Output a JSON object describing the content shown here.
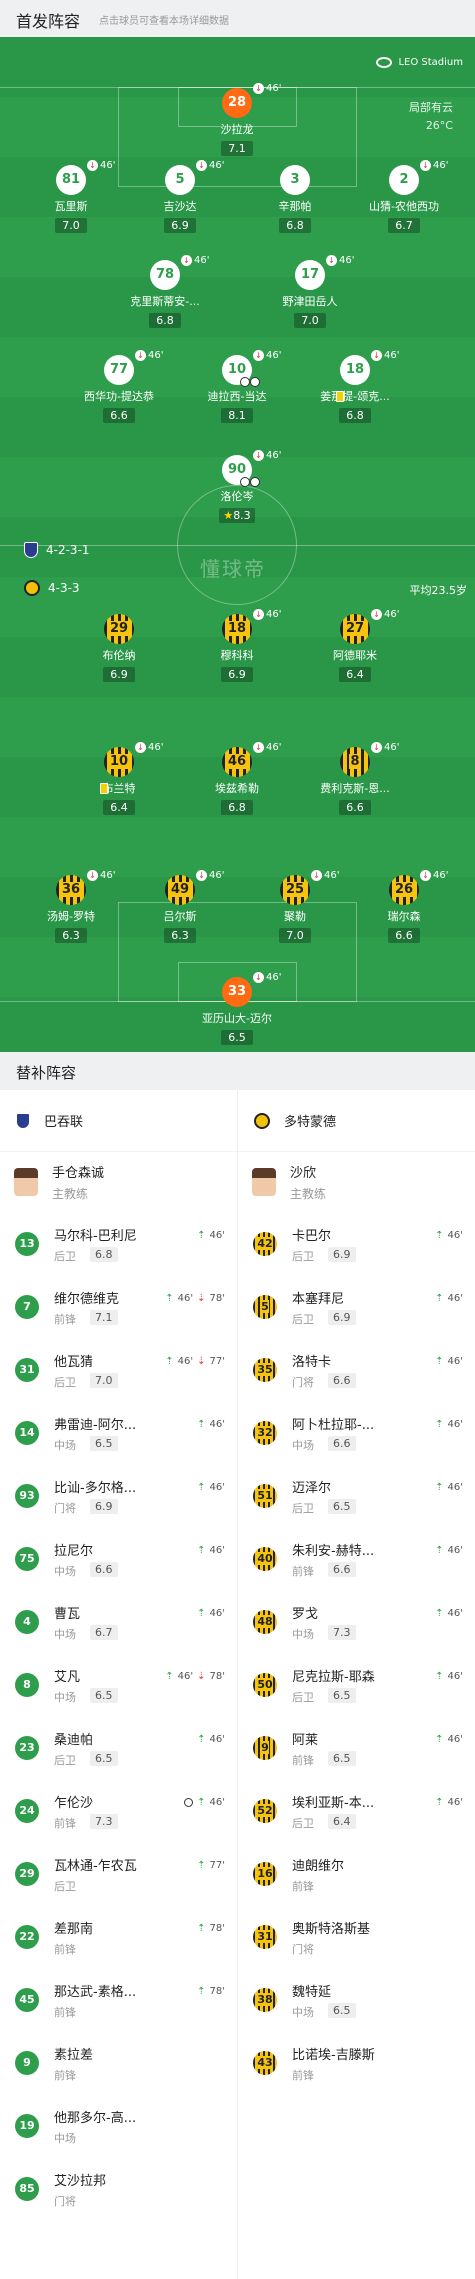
{
  "header": {
    "title": "首发阵容",
    "subtitle": "点击球员可查看本场详细数据"
  },
  "venue": {
    "name": "LEO Stadium",
    "icon": "stadium-icon"
  },
  "weather": {
    "condition": "局部有云",
    "temperature": "26°C"
  },
  "watermark": "懂球帝",
  "home": {
    "formation": "4-2-3-1",
    "players": [
      {
        "num": "28",
        "name": "沙拉龙",
        "rating": "7.1",
        "sub": "46'",
        "gk": true
      },
      {
        "num": "81",
        "name": "瓦里斯",
        "rating": "7.0",
        "sub": "46'"
      },
      {
        "num": "5",
        "name": "吉沙达",
        "rating": "6.9",
        "sub": "46'"
      },
      {
        "num": "3",
        "name": "辛那帕",
        "rating": "6.8",
        "sub": ""
      },
      {
        "num": "2",
        "name": "山猜-农他西功",
        "rating": "6.7",
        "sub": "46'"
      },
      {
        "num": "78",
        "name": "克里斯蒂安-...",
        "rating": "6.8",
        "sub": "46'"
      },
      {
        "num": "17",
        "name": "野津田岳人",
        "rating": "7.0",
        "sub": "46'"
      },
      {
        "num": "77",
        "name": "西华功-提达恭",
        "rating": "6.6",
        "sub": "46'"
      },
      {
        "num": "10",
        "name": "迪拉西-当达",
        "rating": "8.1",
        "sub": "46'"
      },
      {
        "num": "18",
        "name": "姜那提-颂克...",
        "rating": "6.8",
        "sub": "46'"
      },
      {
        "num": "90",
        "name": "洛伦岑",
        "rating": "8.3",
        "sub": "46'"
      }
    ]
  },
  "away": {
    "formation": "4-3-3",
    "avg_age": "平均23.5岁",
    "players": [
      {
        "num": "29",
        "name": "布伦纳",
        "rating": "6.9",
        "sub": ""
      },
      {
        "num": "18",
        "name": "穆科科",
        "rating": "6.9",
        "sub": "46'"
      },
      {
        "num": "27",
        "name": "阿德耶米",
        "rating": "6.4",
        "sub": "46'"
      },
      {
        "num": "10",
        "name": "布兰特",
        "rating": "6.4",
        "sub": "46'"
      },
      {
        "num": "46",
        "name": "埃兹希勒",
        "rating": "6.8",
        "sub": "46'"
      },
      {
        "num": "8",
        "name": "费利克斯-恩...",
        "rating": "6.6",
        "sub": "46'"
      },
      {
        "num": "36",
        "name": "汤姆-罗特",
        "rating": "6.3",
        "sub": "46'"
      },
      {
        "num": "49",
        "name": "吕尔斯",
        "rating": "6.3",
        "sub": "46'"
      },
      {
        "num": "25",
        "name": "聚勒",
        "rating": "7.0",
        "sub": "46'"
      },
      {
        "num": "26",
        "name": "瑞尔森",
        "rating": "6.6",
        "sub": "46'"
      },
      {
        "num": "33",
        "name": "亚历山大-迈尔",
        "rating": "6.5",
        "sub": "46'"
      }
    ]
  },
  "subs": {
    "title": "替补阵容",
    "home_team": "巴吞联",
    "away_team": "多特蒙德",
    "home_coach": {
      "name": "手仓森诚",
      "role": "主教练"
    },
    "away_coach": {
      "name": "沙欣",
      "role": "主教练"
    },
    "home": [
      {
        "num": "13",
        "name": "马尔科-巴利尼",
        "pos": "后卫",
        "rating": "6.8",
        "events": [
          {
            "t": "in",
            "m": "46'"
          }
        ]
      },
      {
        "num": "7",
        "name": "维尔德维克",
        "pos": "前锋",
        "rating": "7.1",
        "events": [
          {
            "t": "in",
            "m": "46'"
          },
          {
            "t": "out",
            "m": "78'"
          }
        ]
      },
      {
        "num": "31",
        "name": "他瓦猜",
        "pos": "后卫",
        "rating": "7.0",
        "events": [
          {
            "t": "in",
            "m": "46'"
          },
          {
            "t": "out",
            "m": "77'"
          }
        ]
      },
      {
        "num": "14",
        "name": "弗雷迪-阿尔...",
        "pos": "中场",
        "rating": "6.5",
        "events": [
          {
            "t": "in",
            "m": "46'"
          }
        ]
      },
      {
        "num": "93",
        "name": "比讪-多尔格...",
        "pos": "门将",
        "rating": "6.9",
        "events": [
          {
            "t": "in",
            "m": "46'"
          }
        ]
      },
      {
        "num": "75",
        "name": "拉尼尔",
        "pos": "中场",
        "rating": "6.6",
        "events": [
          {
            "t": "in",
            "m": "46'"
          }
        ]
      },
      {
        "num": "4",
        "name": "曹瓦",
        "pos": "中场",
        "rating": "6.7",
        "events": [
          {
            "t": "in",
            "m": "46'"
          }
        ]
      },
      {
        "num": "8",
        "name": "艾凡",
        "pos": "中场",
        "rating": "6.5",
        "events": [
          {
            "t": "in",
            "m": "46'"
          },
          {
            "t": "out",
            "m": "78'"
          }
        ]
      },
      {
        "num": "23",
        "name": "桑迪帕",
        "pos": "后卫",
        "rating": "6.5",
        "events": [
          {
            "t": "in",
            "m": "46'"
          }
        ]
      },
      {
        "num": "24",
        "name": "乍伦沙",
        "pos": "前锋",
        "rating": "7.3",
        "events": [
          {
            "t": "goal",
            "m": ""
          },
          {
            "t": "in",
            "m": "46'"
          }
        ]
      },
      {
        "num": "29",
        "name": "瓦林通-乍农瓦",
        "pos": "后卫",
        "rating": "",
        "events": [
          {
            "t": "in",
            "m": "77'"
          }
        ]
      },
      {
        "num": "22",
        "name": "差那南",
        "pos": "前锋",
        "rating": "",
        "events": [
          {
            "t": "in",
            "m": "78'"
          }
        ]
      },
      {
        "num": "45",
        "name": "那达武-素格...",
        "pos": "前锋",
        "rating": "",
        "events": [
          {
            "t": "in",
            "m": "78'"
          }
        ]
      },
      {
        "num": "9",
        "name": "素拉差",
        "pos": "前锋",
        "rating": "",
        "events": []
      },
      {
        "num": "19",
        "name": "他那多尔-高...",
        "pos": "中场",
        "rating": "",
        "events": []
      },
      {
        "num": "85",
        "name": "艾沙拉邦",
        "pos": "门将",
        "rating": "",
        "events": []
      }
    ],
    "away": [
      {
        "num": "42",
        "name": "卡巴尔",
        "pos": "后卫",
        "rating": "6.9",
        "events": [
          {
            "t": "in",
            "m": "46'"
          }
        ]
      },
      {
        "num": "5",
        "name": "本塞拜尼",
        "pos": "后卫",
        "rating": "6.9",
        "events": [
          {
            "t": "in",
            "m": "46'"
          }
        ]
      },
      {
        "num": "35",
        "name": "洛特卡",
        "pos": "门将",
        "rating": "6.6",
        "events": [
          {
            "t": "in",
            "m": "46'"
          }
        ]
      },
      {
        "num": "32",
        "name": "阿卜杜拉耶-...",
        "pos": "中场",
        "rating": "6.6",
        "events": [
          {
            "t": "in",
            "m": "46'"
          }
        ]
      },
      {
        "num": "51",
        "name": "迈泽尔",
        "pos": "后卫",
        "rating": "6.5",
        "events": [
          {
            "t": "in",
            "m": "46'"
          }
        ]
      },
      {
        "num": "40",
        "name": "朱利安-赫特...",
        "pos": "前锋",
        "rating": "6.6",
        "events": [
          {
            "t": "in",
            "m": "46'"
          }
        ]
      },
      {
        "num": "48",
        "name": "罗戈",
        "pos": "中场",
        "rating": "7.3",
        "events": [
          {
            "t": "in",
            "m": "46'"
          }
        ]
      },
      {
        "num": "50",
        "name": "尼克拉斯-耶森",
        "pos": "后卫",
        "rating": "6.5",
        "events": [
          {
            "t": "in",
            "m": "46'"
          }
        ]
      },
      {
        "num": "9",
        "name": "阿莱",
        "pos": "前锋",
        "rating": "6.5",
        "events": [
          {
            "t": "in",
            "m": "46'"
          }
        ]
      },
      {
        "num": "52",
        "name": "埃利亚斯-本...",
        "pos": "后卫",
        "rating": "6.4",
        "events": [
          {
            "t": "in",
            "m": "46'"
          }
        ]
      },
      {
        "num": "16",
        "name": "迪朗维尔",
        "pos": "前锋",
        "rating": "",
        "events": []
      },
      {
        "num": "31",
        "name": "奥斯特洛斯基",
        "pos": "门将",
        "rating": "",
        "events": []
      },
      {
        "num": "38",
        "name": "魏特延",
        "pos": "中场",
        "rating": "6.5",
        "events": []
      },
      {
        "num": "43",
        "name": "比诺埃-吉滕斯",
        "pos": "前锋",
        "rating": "",
        "events": []
      }
    ]
  },
  "colors": {
    "pitch": "#2e9e4d",
    "away_yellow": "#f6c40f",
    "home_gk": "#ff6a13",
    "sub_in": "#2e9e4d",
    "sub_out": "#e53935"
  }
}
